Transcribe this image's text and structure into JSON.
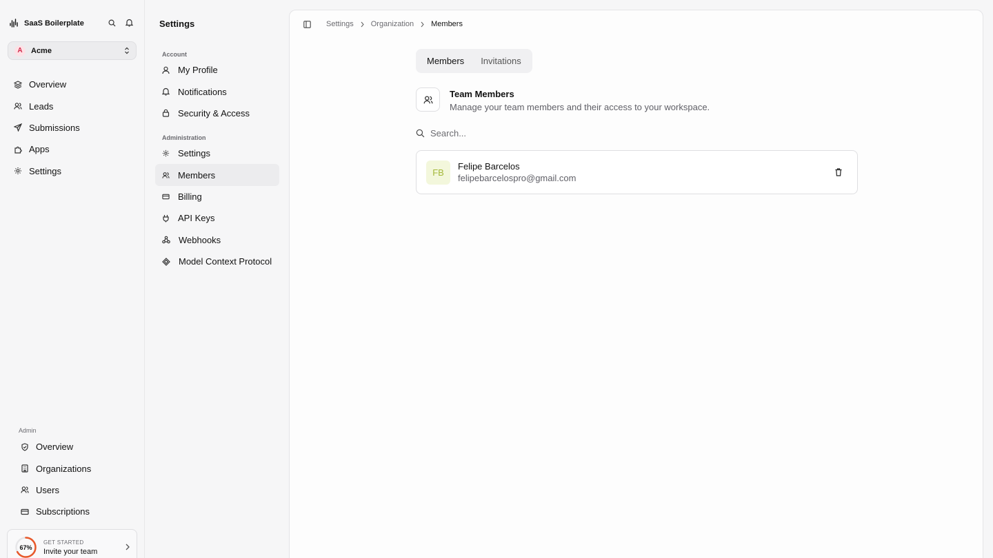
{
  "app": {
    "name": "SaaS Boilerplate",
    "organization": {
      "initial": "A",
      "name": "Acme"
    }
  },
  "sidebar": {
    "items": [
      {
        "label": "Overview",
        "icon": "layers-icon"
      },
      {
        "label": "Leads",
        "icon": "users-icon"
      },
      {
        "label": "Submissions",
        "icon": "send-icon"
      },
      {
        "label": "Apps",
        "icon": "puzzle-icon"
      },
      {
        "label": "Settings",
        "icon": "gear-icon"
      }
    ],
    "admin_heading": "Admin",
    "admin_items": [
      {
        "label": "Overview",
        "icon": "shield-icon"
      },
      {
        "label": "Organizations",
        "icon": "building-icon"
      },
      {
        "label": "Users",
        "icon": "users-icon"
      },
      {
        "label": "Subscriptions",
        "icon": "card-icon"
      }
    ],
    "progress": {
      "percent_label": "67%",
      "value": 0.67,
      "kicker": "GET STARTED",
      "title": "Invite your team"
    }
  },
  "settings_nav": {
    "title": "Settings",
    "account_heading": "Account",
    "account_items": [
      {
        "label": "My Profile",
        "icon": "user-icon"
      },
      {
        "label": "Notifications",
        "icon": "bell-icon"
      },
      {
        "label": "Security & Access",
        "icon": "lock-icon"
      }
    ],
    "admin_heading": "Administration",
    "admin_items": [
      {
        "label": "Settings",
        "icon": "gear-icon"
      },
      {
        "label": "Members",
        "icon": "users-icon"
      },
      {
        "label": "Billing",
        "icon": "card-icon"
      },
      {
        "label": "API Keys",
        "icon": "plug-icon"
      },
      {
        "label": "Webhooks",
        "icon": "webhook-icon"
      },
      {
        "label": "Model Context Protocol",
        "icon": "mcp-icon"
      }
    ]
  },
  "breadcrumb": [
    "Settings",
    "Organization",
    "Members"
  ],
  "tabs": [
    "Members",
    "Invitations"
  ],
  "section": {
    "title": "Team Members",
    "description": "Manage your team members and their access to your workspace."
  },
  "search": {
    "placeholder": "Search...",
    "value": ""
  },
  "members": [
    {
      "initials": "FB",
      "name": "Felipe Barcelos",
      "email": "felipebarcelospro@gmail.com"
    }
  ],
  "colors": {
    "accent_ring": "#e8582a",
    "avatar_bg": "#f3f7dc",
    "avatar_text": "#a4b83a"
  }
}
